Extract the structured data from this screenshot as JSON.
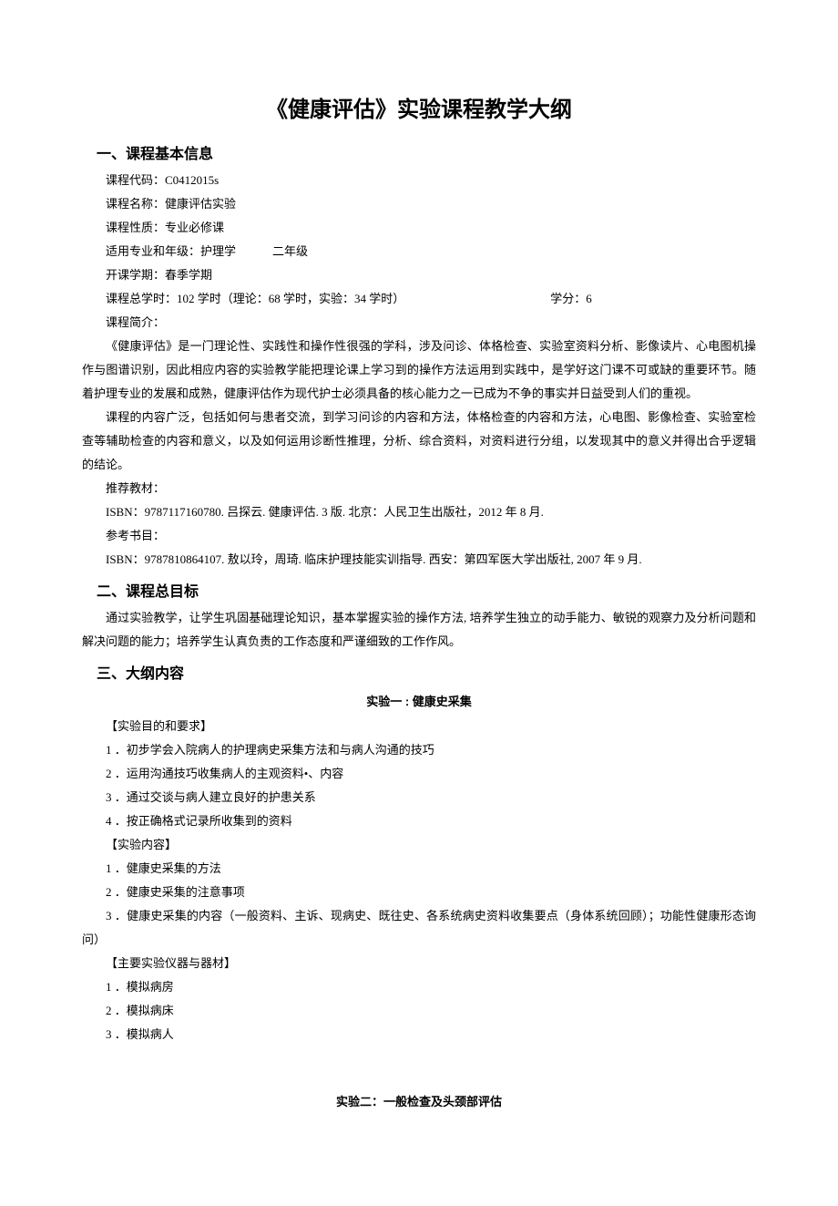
{
  "title": "《健康评估》实验课程教学大纲",
  "section1": {
    "heading": "一、课程基本信息",
    "code_label": "课程代码：",
    "code": "C0412015s",
    "name_label": "课程名称：",
    "name": "健康评估实验",
    "nature_label": "课程性质：",
    "nature": "专业必修课",
    "apply_label": "适用专业和年级：",
    "apply_major": "护理学",
    "apply_grade": "二年级",
    "semester_label": "开课学期：",
    "semester": "春季学期",
    "hours_label": "课程总学时：",
    "hours": "102 学时（理论：68 学时，实验：34 学时）",
    "credit_label": "学分：",
    "credit": "6",
    "intro_label": "课程简介：",
    "intro_p1": "《健康评估》是一门理论性、实践性和操作性很强的学科，涉及问诊、体格检查、实验室资料分析、影像读片、心电图机操作与图谱识别，因此相应内容的实验教学能把理论课上学习到的操作方法运用到实践中，是学好这门课不可或缺的重要环节。随着护理专业的发展和成熟，健康评估作为现代护士必须具备的核心能力之一已成为不争的事实并日益受到人们的重视。",
    "intro_p2": "课程的内容广泛，包括如何与患者交流，到学习问诊的内容和方法，体格检查的内容和方法，心电图、影像检查、实验室检查等辅助检查的内容和意义，以及如何运用诊断性推理，分析、综合资料，对资料进行分组，以发现其中的意义并得出合乎逻辑的结论。",
    "textbook_label": "推荐教材：",
    "textbook": "ISBN：9787117160780. 吕探云. 健康评估. 3 版. 北京：人民卫生出版社，2012 年 8 月.",
    "ref_label": "参考书目：",
    "ref": "ISBN：9787810864107. 敖以玲，周琦. 临床护理技能实训指导. 西安：第四军医大学出版社, 2007 年 9 月."
  },
  "section2": {
    "heading": "二、课程总目标",
    "body": "通过实验教学，让学生巩固基础理论知识，基本掌握实验的操作方法, 培养学生独立的动手能力、敏锐的观察力及分析问题和解决问题的能力；培养学生认真负责的工作态度和严谨细致的工作作风。"
  },
  "section3": {
    "heading": "三、大纲内容",
    "exp1": {
      "title": "实验一 : 健康史采集",
      "h_purpose": "【实验目的和要求】",
      "purpose": [
        "1 ．初步学会入院病人的护理病史采集方法和与病人沟通的技巧",
        "2 ．运用沟通技巧收集病人的主观资料•、内容",
        "3 ．通过交谈与病人建立良好的护患关系",
        "4 ．按正确格式记录所收集到的资料"
      ],
      "h_content": "【实验内容】",
      "content": [
        "1 ．健康史采集的方法",
        "2 ．健康史采集的注意事项",
        "3 ．健康史采集的内容（一般资料、主诉、现病史、既往史、各系统病史资料收集要点（身体系统回顾）；功能性健康形态询问）"
      ],
      "h_equip": "【主要实验仪器与器材】",
      "equip": [
        "1 ．模拟病房",
        "2 ．模拟病床",
        "3 ．模拟病人"
      ]
    },
    "exp2": {
      "title": "实验二：一般检查及头颈部评估"
    }
  }
}
